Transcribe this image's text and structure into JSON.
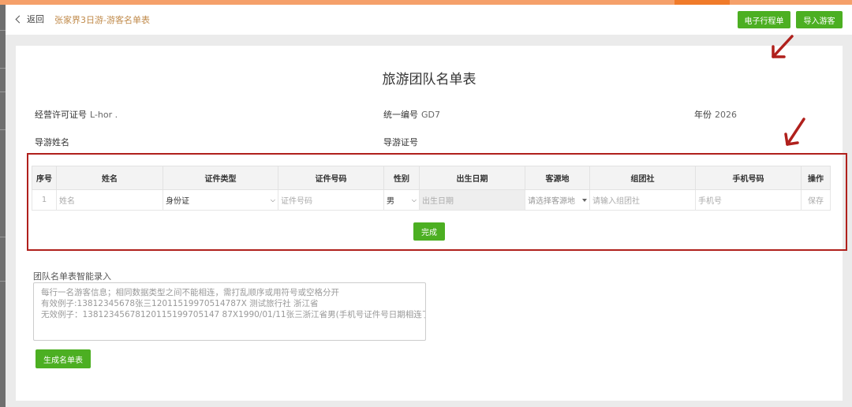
{
  "header": {
    "back_label": "返回",
    "breadcrumb": "张家界3日游-游客名单表",
    "btn_itinerary": "电子行程单",
    "btn_import": "导入游客"
  },
  "page": {
    "title": "旅游团队名单表",
    "license_label": "经营许可证号",
    "license_value": "L-hor .",
    "unified_label": "统一编号",
    "unified_value": "GD7",
    "year_label": "年份",
    "year_value": "2026",
    "guide_name_label": "导游姓名",
    "guide_cert_label": "导游证号"
  },
  "table": {
    "columns": [
      "序号",
      "姓名",
      "证件类型",
      "证件号码",
      "性别",
      "出生日期",
      "客源地",
      "组团社",
      "手机号码",
      "操作"
    ],
    "row": {
      "index": "1",
      "name_placeholder": "姓名",
      "cert_type": "身份证",
      "cert_no_placeholder": "证件号码",
      "gender": "男",
      "birth_placeholder": "出生日期",
      "origin_placeholder": "请选择客源地",
      "agency_placeholder": "请输入组团社",
      "phone_placeholder": "手机号",
      "action": "保存"
    },
    "done_label": "完成"
  },
  "smart": {
    "label": "团队名单表智能录入",
    "placeholder": "每行一名游客信息；相同数据类型之间不能相连，需打乱顺序或用符号或空格分开\n有效例子:13812345678张三12011519970514787X 测试旅行社 浙江省\n无效例子：13812345678120115199705147 87X1990/01/11张三浙江省男(手机号证件号日期相连了)",
    "generate_label": "生成名单表"
  },
  "colors": {
    "accent_green": "#4caf22",
    "annotation_red": "#b0201c",
    "breadcrumb": "#c08a4a",
    "action_orange": "#e09a3c"
  }
}
